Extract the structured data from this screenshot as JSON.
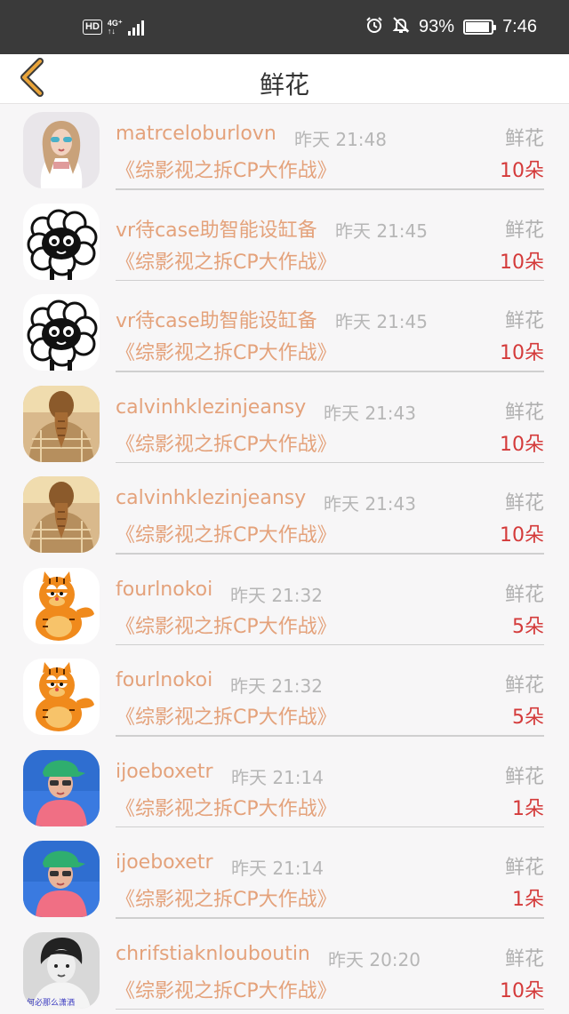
{
  "status_bar": {
    "hd": "HD",
    "network": "4G⁺",
    "network_sub": "↑↓",
    "battery": "93%",
    "time": "7:46",
    "icons": [
      "alarm-icon",
      "bell-muted-icon",
      "battery-icon"
    ]
  },
  "nav": {
    "title": "鲜花",
    "back_icon": "chevron-left-icon",
    "accent": "#e9a43a"
  },
  "colors": {
    "username": "#e4a27b",
    "time": "#b6b6b6",
    "count": "#d43a3a"
  },
  "records": [
    {
      "avatar": "avatar-girl-sunglasses",
      "username": "matrceloburlovn",
      "time": "昨天 21:48",
      "gift": "鲜花",
      "show": "《综影视之拆CP大作战》",
      "count": "10朵"
    },
    {
      "avatar": "avatar-sheep",
      "username": "vr待case助智能设缸备",
      "time": "昨天 21:45",
      "gift": "鲜花",
      "show": "《综影视之拆CP大作战》",
      "count": "10朵"
    },
    {
      "avatar": "avatar-sheep",
      "username": "vr待case助智能设缸备",
      "time": "昨天 21:45",
      "gift": "鲜花",
      "show": "《综影视之拆CP大作战》",
      "count": "10朵"
    },
    {
      "avatar": "avatar-woman-back",
      "username": "calvinhklezinjeansy",
      "time": "昨天 21:43",
      "gift": "鲜花",
      "show": "《综影视之拆CP大作战》",
      "count": "10朵"
    },
    {
      "avatar": "avatar-woman-back",
      "username": "calvinhklezinjeansy",
      "time": "昨天 21:43",
      "gift": "鲜花",
      "show": "《综影视之拆CP大作战》",
      "count": "10朵"
    },
    {
      "avatar": "avatar-garfield",
      "username": "fourlnokoi",
      "time": "昨天 21:32",
      "gift": "鲜花",
      "show": "《综影视之拆CP大作战》",
      "count": "5朵"
    },
    {
      "avatar": "avatar-garfield",
      "username": "fourlnokoi",
      "time": "昨天 21:32",
      "gift": "鲜花",
      "show": "《综影视之拆CP大作战》",
      "count": "5朵"
    },
    {
      "avatar": "avatar-boy-cap",
      "username": "ijoeboxetr",
      "time": "昨天 21:14",
      "gift": "鲜花",
      "show": "《综影视之拆CP大作战》",
      "count": "1朵"
    },
    {
      "avatar": "avatar-boy-cap",
      "username": "ijoeboxetr",
      "time": "昨天 21:14",
      "gift": "鲜花",
      "show": "《综影视之拆CP大作战》",
      "count": "1朵"
    },
    {
      "avatar": "avatar-bw-portrait",
      "username": "chrifstiaknlouboutin",
      "time": "昨天 20:20",
      "gift": "鲜花",
      "show": "《综影视之拆CP大作战》",
      "count": "10朵",
      "avatar_caption": "何必那么潇洒"
    }
  ]
}
